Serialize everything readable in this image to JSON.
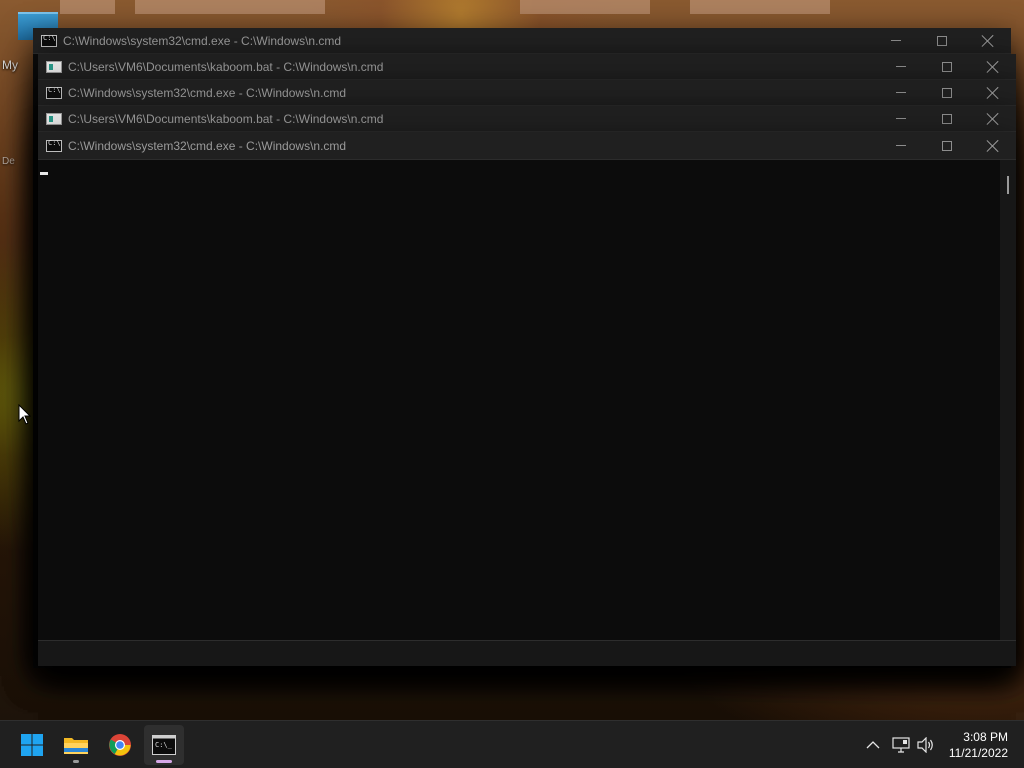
{
  "desktop": {
    "fragment_top": "My",
    "fragment_bottom": "De"
  },
  "windows": [
    {
      "title": "C:\\Windows\\system32\\cmd.exe - C:\\Windows\\n.cmd",
      "icon": "cmd-icon"
    },
    {
      "title": "C:\\Users\\VM6\\Documents\\kaboom.bat - C:\\Windows\\n.cmd",
      "icon": "batch-file-icon"
    },
    {
      "title": "C:\\Windows\\system32\\cmd.exe - C:\\Windows\\n.cmd",
      "icon": "cmd-icon"
    },
    {
      "title": "C:\\Users\\VM6\\Documents\\kaboom.bat - C:\\Windows\\n.cmd",
      "icon": "batch-file-icon"
    },
    {
      "title": "C:\\Windows\\system32\\cmd.exe - C:\\Windows\\n.cmd",
      "icon": "cmd-icon"
    }
  ],
  "taskbar": {
    "apps": [
      {
        "name": "Start",
        "icon": "windows-start-icon"
      },
      {
        "name": "File Explorer",
        "icon": "folder-icon"
      },
      {
        "name": "Google Chrome",
        "icon": "chrome-icon"
      },
      {
        "name": "Command Prompt",
        "icon": "terminal-icon",
        "active": true
      }
    ],
    "tray": {
      "icons": [
        "chevron-up-icon",
        "network-icon",
        "volume-icon"
      ]
    },
    "clock": {
      "time": "3:08 PM",
      "date": "11/21/2022"
    }
  },
  "colors": {
    "console_bg": "#0c0c0c",
    "titlebar_bg": "#202020",
    "title_text": "#9a9a9a",
    "taskbar_bg": "#202020"
  }
}
